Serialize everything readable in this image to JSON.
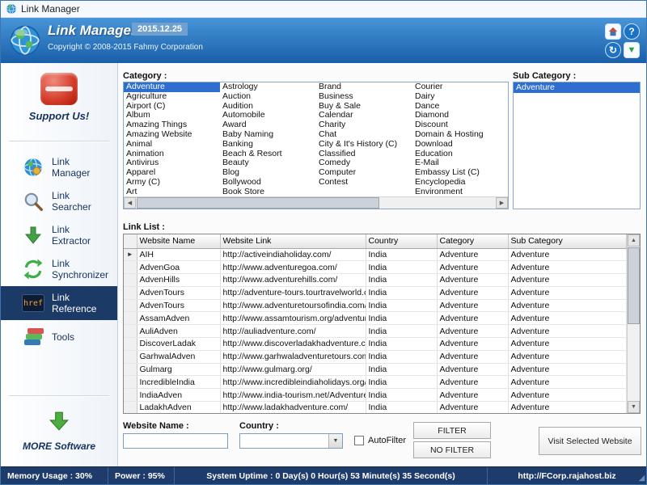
{
  "titlebar": {
    "title": "Link Manager"
  },
  "header": {
    "title": "Link Manager",
    "version": "2015.12.25",
    "copyright": "Copyright © 2008-2015 Fahmy Corporation"
  },
  "sidebar": {
    "support_label": "Support Us!",
    "href_text": "href",
    "more_label": "MORE Software",
    "items": [
      {
        "label": "Link Manager",
        "active": false
      },
      {
        "label": "Link Searcher",
        "active": false
      },
      {
        "label": "Link Extractor",
        "active": false
      },
      {
        "label": "Link Synchronizer",
        "active": false
      },
      {
        "label": "Link Reference",
        "active": true
      },
      {
        "label": "Tools",
        "active": false
      }
    ]
  },
  "category": {
    "label": "Category :",
    "selected": "Adventure",
    "columns": [
      [
        "Adventure",
        "Agriculture",
        "Airport (C)",
        "Album",
        "Amazing Things",
        "Amazing Website",
        "Animal",
        "Animation",
        "Antivirus",
        "Apparel",
        "Army (C)",
        "Art"
      ],
      [
        "Astrology",
        "Auction",
        "Audition",
        "Automobile",
        "Award",
        "Baby Naming",
        "Banking",
        "Beach & Resort",
        "Beauty",
        "Blog",
        "Bollywood",
        "Book Store"
      ],
      [
        "Brand",
        "Business",
        "Buy & Sale",
        "Calendar",
        "Charity",
        "Chat",
        "City & It's History (C)",
        "Classified",
        "Comedy",
        "Computer",
        "Contest"
      ],
      [
        "Courier",
        "Dairy",
        "Dance",
        "Diamond",
        "Discount",
        "Domain & Hosting",
        "Download",
        "Education",
        "E-Mail",
        "Embassy List (C)",
        "Encyclopedia",
        "Environment"
      ]
    ]
  },
  "subcategory": {
    "label": "Sub Category :",
    "selected": "Adventure",
    "items": [
      "Adventure"
    ]
  },
  "linklist": {
    "label": "Link List :",
    "headers": [
      "Website Name",
      "Website Link",
      "Country",
      "Category",
      "Sub Category"
    ],
    "rows": [
      [
        "AIH",
        "http://activeindiaholiday.com/",
        "India",
        "Adventure",
        "Adventure"
      ],
      [
        "AdvenGoa",
        "http://www.adventuregoa.com/",
        "India",
        "Adventure",
        "Adventure"
      ],
      [
        "AdvenHills",
        "http://www.adventurehills.com/",
        "India",
        "Adventure",
        "Adventure"
      ],
      [
        "AdvenTours",
        "http://adventure-tours.tourtravelworld.com",
        "India",
        "Adventure",
        "Adventure"
      ],
      [
        "AdvenTours",
        "http://www.adventuretoursofindia.com/ad",
        "India",
        "Adventure",
        "Adventure"
      ],
      [
        "AssamAdven",
        "http://www.assamtourism.org/adventure.p",
        "India",
        "Adventure",
        "Adventure"
      ],
      [
        "AuliAdven",
        "http://auliadventure.com/",
        "India",
        "Adventure",
        "Adventure"
      ],
      [
        "DiscoverLadak",
        "http://www.discoverladakhadventure.com",
        "India",
        "Adventure",
        "Adventure"
      ],
      [
        "GarhwalAdven",
        "http://www.garhwaladventuretours.com/",
        "India",
        "Adventure",
        "Adventure"
      ],
      [
        "Gulmarg",
        "http://www.gulmarg.org/",
        "India",
        "Adventure",
        "Adventure"
      ],
      [
        "IncredibleIndia",
        "http://www.incredibleindiaholidays.org/",
        "India",
        "Adventure",
        "Adventure"
      ],
      [
        "IndiaAdven",
        "http://www.india-tourism.net/Adventures.l",
        "India",
        "Adventure",
        "Adventure"
      ],
      [
        "LadakhAdven",
        "http://www.ladakhadventure.com/",
        "India",
        "Adventure",
        "Adventure"
      ]
    ]
  },
  "filter": {
    "website_name_label": "Website Name :",
    "website_name_value": "",
    "country_label": "Country :",
    "country_value": "",
    "autofilter_label": "AutoFilter",
    "filter_button": "FILTER",
    "nofilter_button": "NO FILTER",
    "visit_button": "Visit Selected Website"
  },
  "statusbar": {
    "memory": "Memory Usage : 30%",
    "power": "Power : 95%",
    "uptime": "System Uptime : 0 Day(s) 0 Hour(s) 53 Minute(s) 35 Second(s)",
    "url": "http://FCorp.rajahost.biz"
  },
  "icons": {
    "row_marker": "►",
    "arrow_up": "▲",
    "arrow_down": "▼",
    "arrow_left": "◀",
    "arrow_right": "▶",
    "help": "?",
    "sync": "↻",
    "combo_arrow": "▼",
    "grip": "◢"
  }
}
